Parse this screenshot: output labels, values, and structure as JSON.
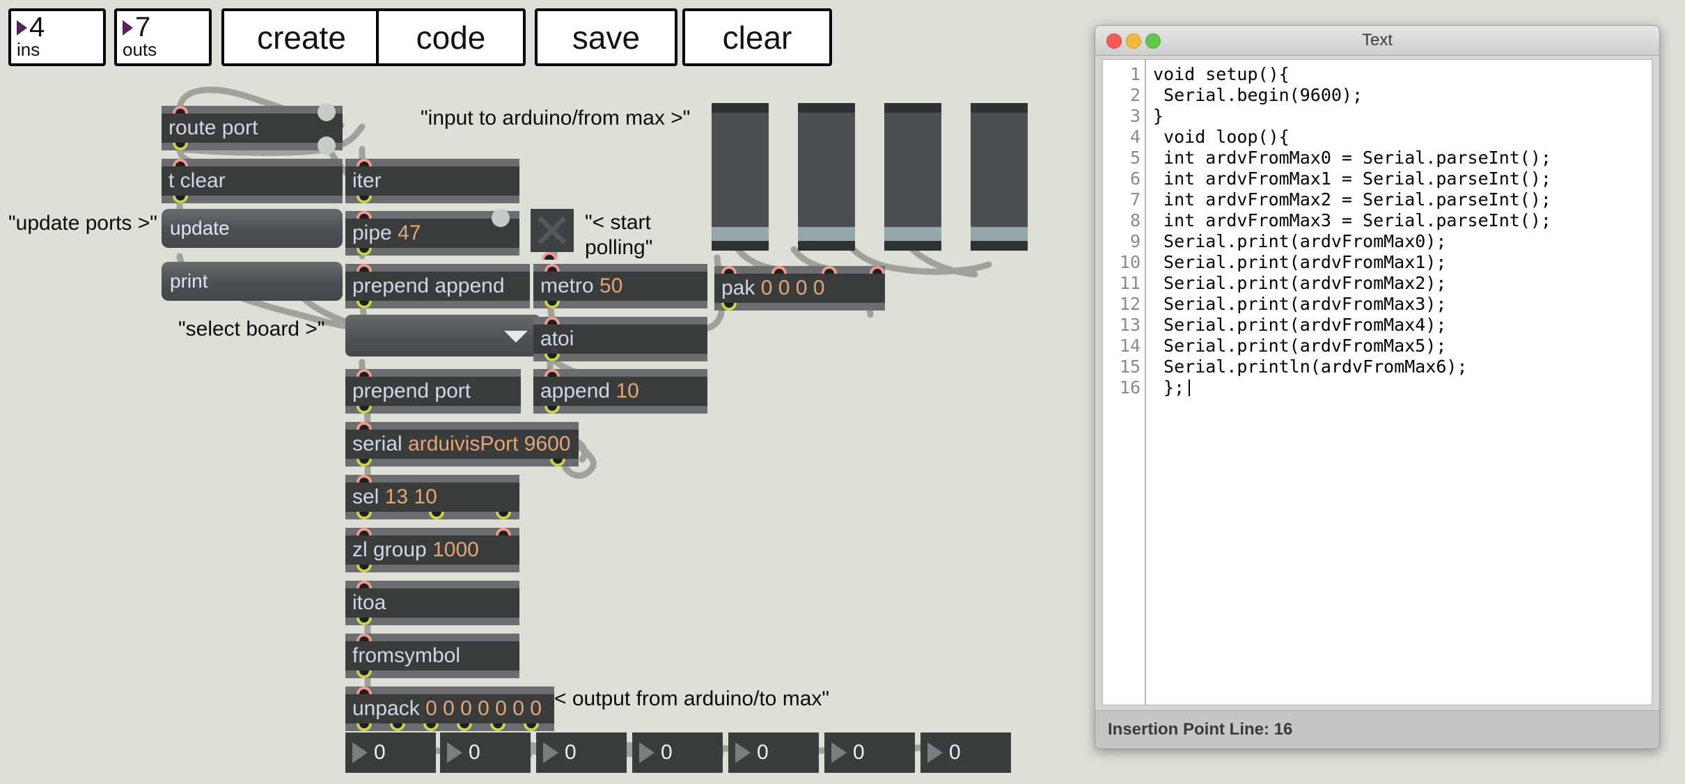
{
  "toolbar": {
    "ins": {
      "value": "4",
      "label": "ins"
    },
    "outs": {
      "value": "7",
      "label": "outs"
    },
    "create": "create",
    "code": "code",
    "save": "save",
    "clear": "clear"
  },
  "patcher": {
    "objects": [
      {
        "id": "route_port",
        "text": "route port"
      },
      {
        "id": "t_clear",
        "text": "t clear"
      },
      {
        "id": "iter",
        "text": "iter"
      },
      {
        "id": "pipe",
        "name": "pipe",
        "arg": "47"
      },
      {
        "id": "prepend_append",
        "text": "prepend append"
      },
      {
        "id": "metro",
        "name": "metro",
        "arg": "50"
      },
      {
        "id": "pak",
        "name": "pak",
        "arg": "0 0 0 0"
      },
      {
        "id": "atoi",
        "text": "atoi"
      },
      {
        "id": "prepend_port",
        "text": "prepend port"
      },
      {
        "id": "append_10",
        "name": "append",
        "arg": "10"
      },
      {
        "id": "serial",
        "name": "serial",
        "arg": "arduivisPort 9600"
      },
      {
        "id": "sel",
        "name": "sel",
        "arg": "13 10"
      },
      {
        "id": "zl_group",
        "name": "zl group",
        "arg": "1000"
      },
      {
        "id": "itoa",
        "text": "itoa"
      },
      {
        "id": "fromsymbol",
        "text": "fromsymbol"
      },
      {
        "id": "unpack",
        "name": "unpack",
        "arg": "0 0 0 0 0 0 0"
      }
    ],
    "messages": [
      {
        "id": "update",
        "text": "update"
      },
      {
        "id": "print",
        "text": "print"
      }
    ],
    "umenu": {
      "id": "port-menu",
      "value": "",
      "arrow": "chevron-down-icon"
    },
    "toggle": {
      "id": "polling-toggle",
      "state": "on"
    },
    "comments": [
      {
        "id": "update-ports",
        "text": "\"update ports >\""
      },
      {
        "id": "select-board",
        "text": "\"select board >\""
      },
      {
        "id": "input-to-ard",
        "text": "\"input to arduino/from max >\""
      },
      {
        "id": "start-polling",
        "text": "\"< start\npolling\""
      },
      {
        "id": "output-from",
        "text": "< output from arduino/to max\""
      }
    ],
    "sliders": [
      {
        "id": "slider-1",
        "value": 0
      },
      {
        "id": "slider-2",
        "value": 0
      },
      {
        "id": "slider-3",
        "value": 0
      },
      {
        "id": "slider-4",
        "value": 0
      }
    ],
    "number_boxes": [
      "0",
      "0",
      "0",
      "0",
      "0",
      "0",
      "0"
    ]
  },
  "text_window": {
    "title": "Text",
    "traffic_lights": [
      "close-icon",
      "minimize-icon",
      "zoom-icon"
    ],
    "line_numbers": [
      "1",
      "2",
      "3",
      "4",
      "5",
      "6",
      "7",
      "8",
      "9",
      "10",
      "11",
      "12",
      "13",
      "14",
      "15",
      "16"
    ],
    "code": "void setup(){\n Serial.begin(9600);\n}\n void loop(){\n int ardvFromMax0 = Serial.parseInt();\n int ardvFromMax1 = Serial.parseInt();\n int ardvFromMax2 = Serial.parseInt();\n int ardvFromMax3 = Serial.parseInt();\n Serial.print(ardvFromMax0);\n Serial.print(ardvFromMax1);\n Serial.print(ardvFromMax2);\n Serial.print(ardvFromMax3);\n Serial.print(ardvFromMax4);\n Serial.print(ardvFromMax5);\n Serial.println(ardvFromMax6);\n };",
    "status": "Insertion Point Line: 16"
  },
  "colors": {
    "canvas": "#dedfd7",
    "object_body": "#3a3c3c",
    "object_border": "#6b6d70",
    "object_text": "#cfd8e6",
    "arg_text": "#e4a678",
    "inlet": "#f09b8c",
    "outlet": "#cbd44a",
    "slider_fill": "#95a6ab",
    "menu_triangle": "#e8e8e8",
    "numbox_triangle": "#7b7e80",
    "num_arrow_purple": "#59205e"
  }
}
